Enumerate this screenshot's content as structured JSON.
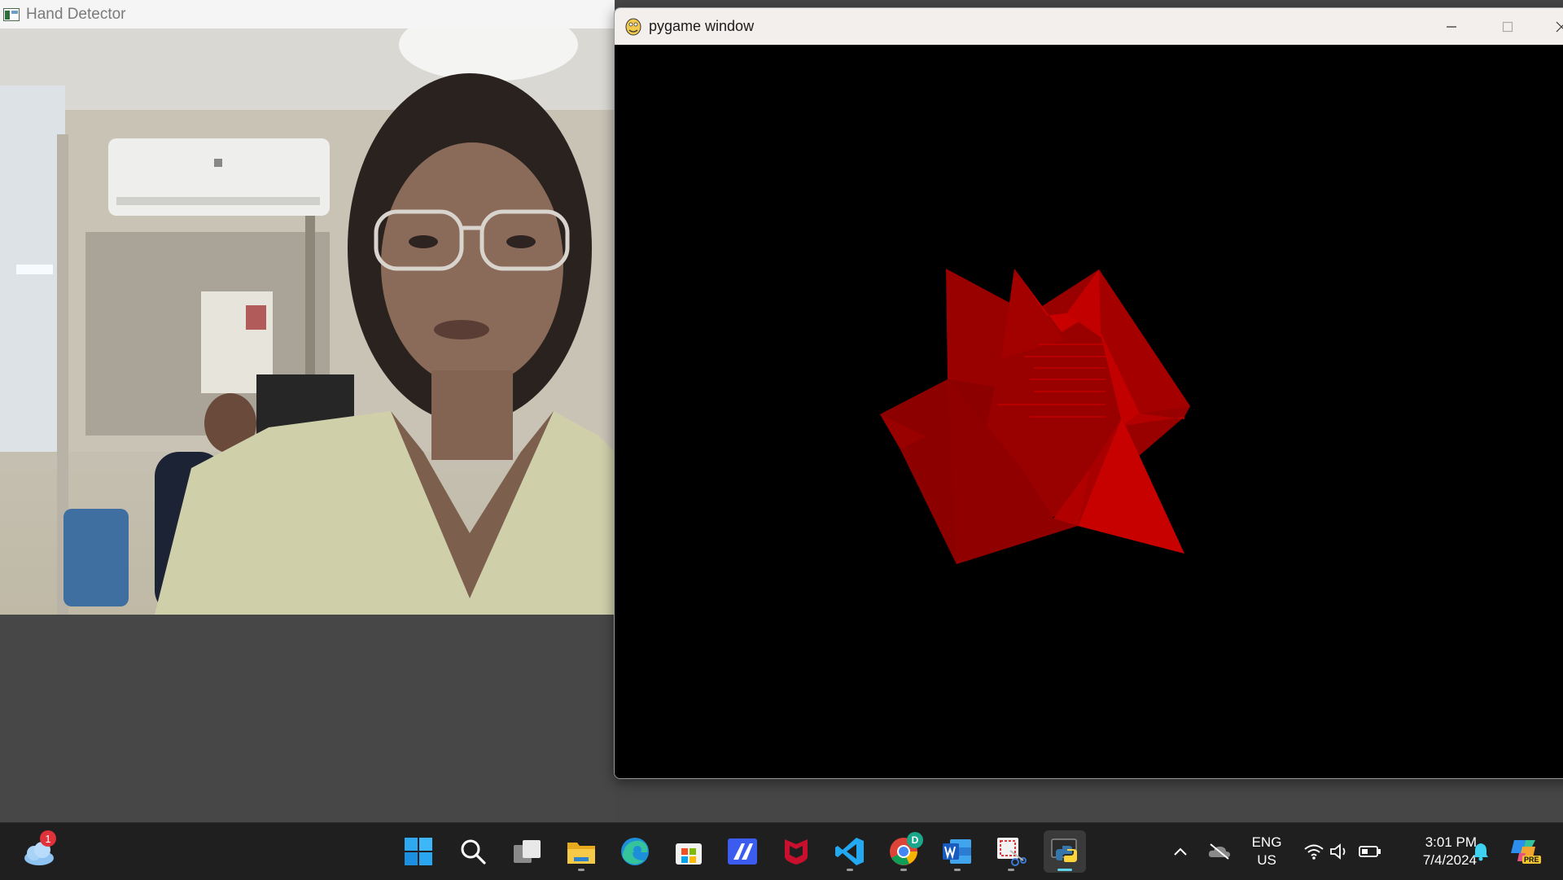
{
  "hand_detector": {
    "title": "Hand Detector"
  },
  "pygame": {
    "title": "pygame window",
    "shape_color": "#c00000"
  },
  "taskbar": {
    "weather_badge": "1",
    "chrome_badge": "D",
    "apps": [
      "start-icon",
      "search-icon",
      "task-view-icon",
      "file-explorer-icon",
      "edge-icon",
      "microsoft-store-icon",
      "ai-app-icon",
      "mcafee-icon",
      "vscode-icon",
      "chrome-icon",
      "word-icon",
      "snipping-tool-icon",
      "python-icon"
    ]
  },
  "tray": {
    "language": "ENG",
    "region": "US",
    "time": "3:01 PM",
    "date": "7/4/2024",
    "copilot_label": "PRE"
  }
}
